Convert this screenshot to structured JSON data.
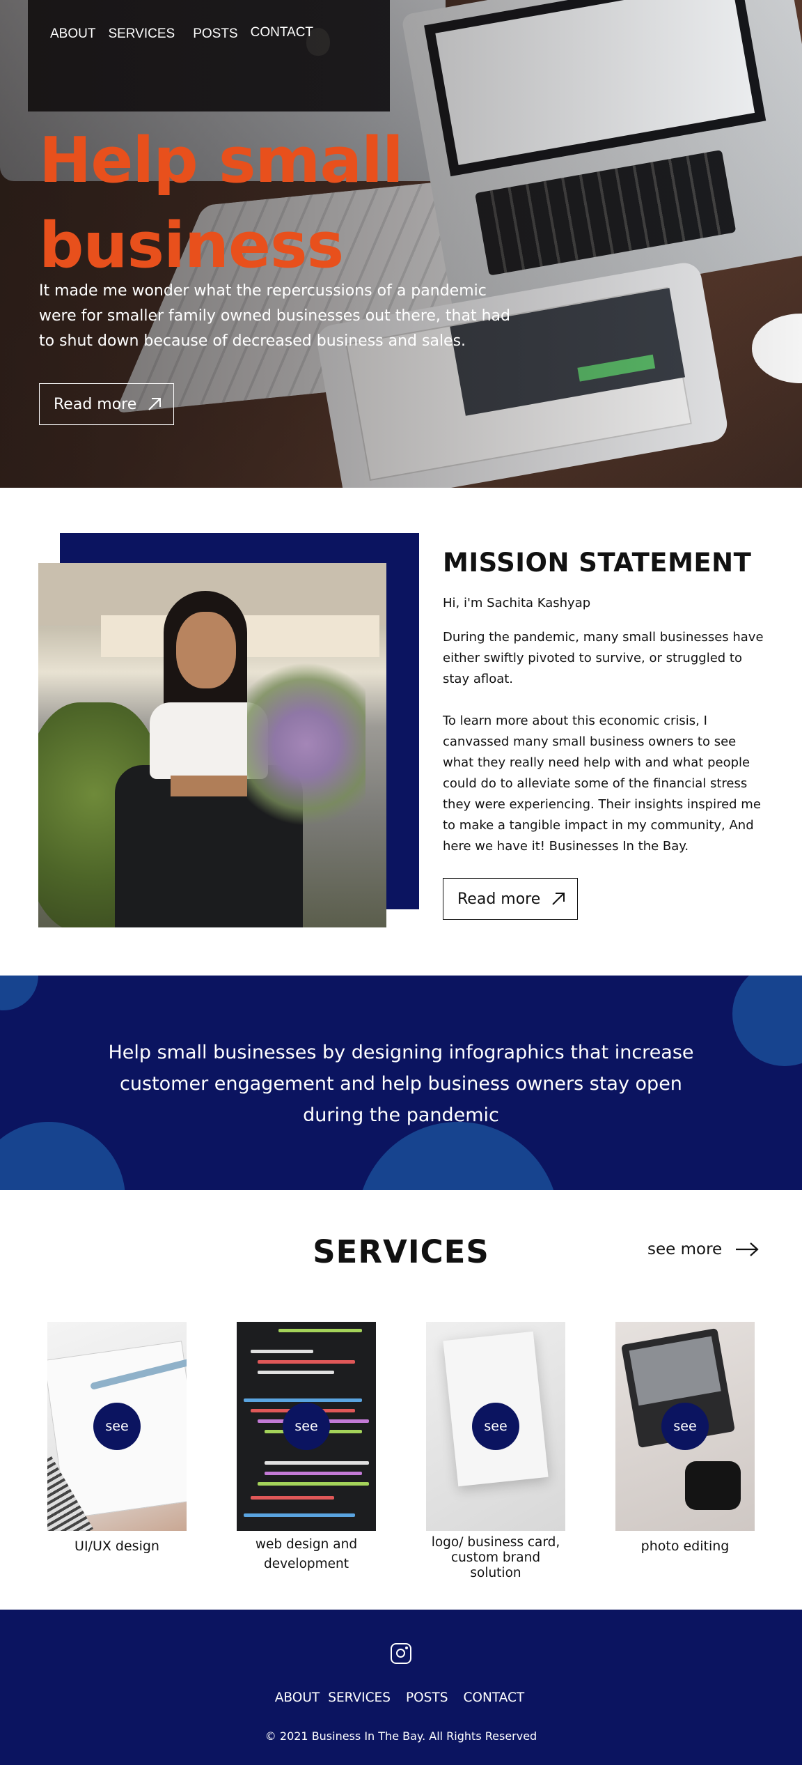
{
  "nav": {
    "items": [
      "ABOUT",
      "SERVICES",
      "POSTS",
      "CONTACT"
    ]
  },
  "hero": {
    "title": "Help small business",
    "text": "It made me wonder what the repercussions of a pandemic were for smaller family owned businesses out there, that had to shut down because of decreased business and sales.",
    "button": "Read more",
    "button_icon": "arrow-up-right-icon"
  },
  "mission": {
    "title": "MISSION STATEMENT",
    "greeting": "Hi, i'm Sachita Kashyap",
    "paragraph1": "During the pandemic, many small businesses have either swiftly pivoted to survive, or struggled to stay afloat.",
    "paragraph2": "To learn more about this economic crisis, I canvassed many small business owners to see what they really need help with and what people could do to alleviate some of the financial stress they were experiencing. Their insights inspired me to make a tangible impact in my community, And here we have it! Businesses In the Bay.",
    "button": "Read more"
  },
  "banner": {
    "text": "Help small businesses by designing infographics that increase customer engagement and help business owners stay open during the pandemic"
  },
  "services": {
    "title": "SERVICES",
    "see_more": "see more",
    "see_label": "see",
    "cards": [
      {
        "caption": "UI/UX design"
      },
      {
        "caption": "web design and development"
      },
      {
        "caption": "logo/ business card, custom brand solution"
      },
      {
        "caption": "photo editing"
      }
    ]
  },
  "footer": {
    "icon": "instagram-icon",
    "nav": [
      "ABOUT",
      "SERVICES",
      "POSTS",
      "CONTACT"
    ],
    "copyright": "© 2021 Business In The Bay. All Rights Reserved"
  },
  "colors": {
    "accent": "#e8501c",
    "navy": "#0b1460",
    "circle_blue": "#17448f"
  }
}
